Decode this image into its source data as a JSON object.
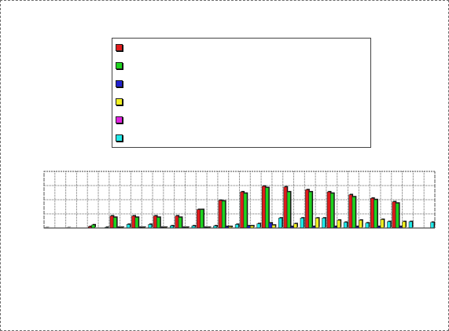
{
  "chart_data": {
    "type": "bar",
    "title": "",
    "xlabel": "",
    "ylabel": "",
    "grid": true,
    "legend_placement": "top-center",
    "ylim": [
      0,
      4
    ],
    "categories": [
      "",
      "",
      "",
      "",
      "",
      "",
      "",
      "",
      "",
      "",
      "",
      "",
      "",
      "",
      "",
      "",
      "",
      ""
    ],
    "series": [
      {
        "name": "",
        "color": "#e01b1b",
        "values": [
          0.02,
          0.02,
          0.1,
          0.85,
          0.85,
          0.85,
          0.85,
          1.3,
          1.95,
          2.55,
          2.95,
          2.9,
          2.7,
          2.55,
          2.35,
          2.1,
          1.85,
          0.0
        ]
      },
      {
        "name": "",
        "color": "#1ed41e",
        "values": [
          0.0,
          0.0,
          0.22,
          0.75,
          0.75,
          0.75,
          0.75,
          1.3,
          1.9,
          2.45,
          2.85,
          2.55,
          2.55,
          2.45,
          2.2,
          2.0,
          1.75,
          0.0
        ]
      },
      {
        "name": "",
        "color": "#2020d0",
        "values": [
          0.0,
          0.0,
          0.0,
          0.05,
          0.05,
          0.05,
          0.05,
          0.05,
          0.1,
          0.15,
          0.35,
          0.1,
          0.1,
          0.1,
          0.1,
          0.1,
          0.1,
          0.0
        ]
      },
      {
        "name": "",
        "color": "#f0f020",
        "values": [
          0.0,
          0.0,
          0.0,
          0.05,
          0.05,
          0.05,
          0.05,
          0.05,
          0.1,
          0.15,
          0.2,
          0.3,
          0.7,
          0.55,
          0.55,
          0.6,
          0.45,
          0.0
        ]
      },
      {
        "name": "",
        "color": "#e020e0",
        "values": [
          0.0,
          0.0,
          0.0,
          0.0,
          0.0,
          0.0,
          0.0,
          0.0,
          0.0,
          0.0,
          0.0,
          0.0,
          0.0,
          0.0,
          0.0,
          0.0,
          0.0,
          0.0
        ]
      },
      {
        "name": "",
        "color": "#20e8e8",
        "values": [
          0.0,
          0.0,
          0.05,
          0.25,
          0.25,
          0.15,
          0.15,
          0.15,
          0.25,
          0.3,
          0.7,
          0.7,
          0.7,
          0.4,
          0.35,
          0.45,
          0.45,
          0.4
        ]
      }
    ]
  }
}
